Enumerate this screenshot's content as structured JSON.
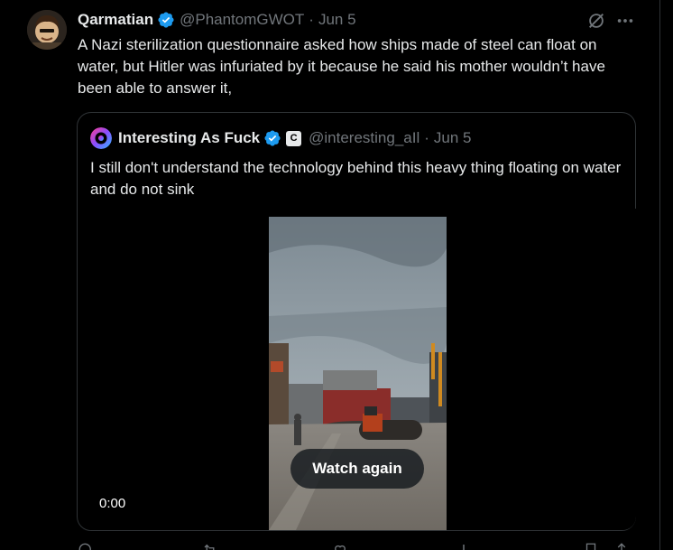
{
  "tweet": {
    "display_name": "Qarmatian",
    "handle": "@PhantomGWOT",
    "separator": "·",
    "date": "Jun 5",
    "text": "A Nazi sterilization questionnaire asked how ships made of steel can float on water, but Hitler was infuriated by it because he said his mother wouldn’t have been able to answer it,"
  },
  "quoted_tweet": {
    "display_name": "Interesting As Fuck",
    "badge": "C",
    "handle": "@interesting_aIl",
    "separator": "·",
    "date": "Jun 5",
    "text": "I still don't understand the technology behind this heavy thing floating on water and do not sink",
    "video": {
      "overlay_button": "Watch again",
      "timestamp": "0:00"
    }
  },
  "icons": {
    "verified": "verified-badge-icon",
    "grok": "grok-icon",
    "more": "more-icon",
    "reply": "reply-icon",
    "repost": "repost-icon",
    "like": "like-icon",
    "views": "views-icon",
    "bookmark": "bookmark-icon",
    "share": "share-icon"
  },
  "colors": {
    "background": "#000000",
    "text": "#e7e9ea",
    "muted": "#71767b",
    "border": "#2f3336",
    "verified": "#1d9bf0"
  }
}
